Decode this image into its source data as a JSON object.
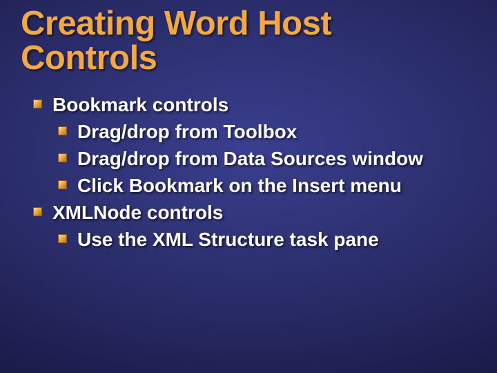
{
  "title": "Creating Word Host Controls",
  "items": [
    {
      "level": 1,
      "text": "Bookmark controls"
    },
    {
      "level": 2,
      "text": "Drag/drop from Toolbox"
    },
    {
      "level": 2,
      "text": "Drag/drop from Data Sources window"
    },
    {
      "level": 2,
      "text": "Click Bookmark on the Insert menu"
    },
    {
      "level": 1,
      "text": "XMLNode controls"
    },
    {
      "level": 2,
      "text": "Use the XML Structure task pane"
    }
  ]
}
